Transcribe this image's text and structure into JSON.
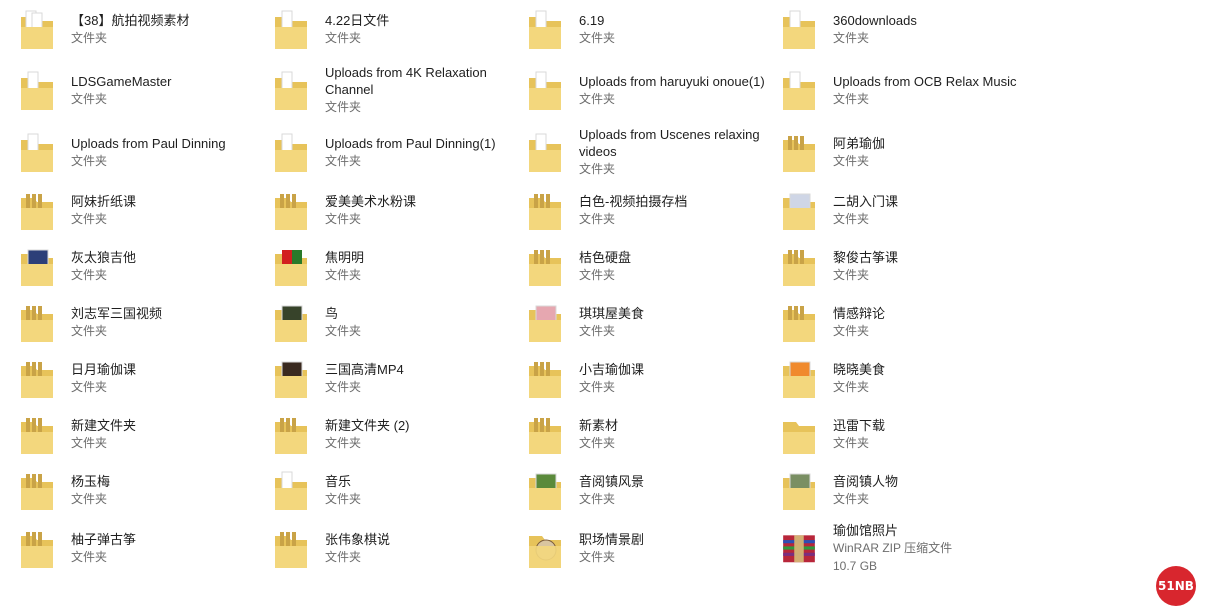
{
  "items": [
    {
      "name": "【38】航拍视频素材",
      "type": "文件夹",
      "icon": "folder-icon"
    },
    {
      "name": "4.22日文件",
      "type": "文件夹",
      "icon": "folder-icon"
    },
    {
      "name": "6.19",
      "type": "文件夹",
      "icon": "folder-icon"
    },
    {
      "name": "360downloads",
      "type": "文件夹",
      "icon": "folder-icon"
    },
    {
      "name": "LDSGameMaster",
      "type": "文件夹",
      "icon": "folder-icon"
    },
    {
      "name": "Uploads from 4K Relaxation Channel",
      "type": "文件夹",
      "icon": "folder-icon"
    },
    {
      "name": "Uploads from haruyuki onoue(1)",
      "type": "文件夹",
      "icon": "folder-icon"
    },
    {
      "name": "Uploads from OCB Relax Music",
      "type": "文件夹",
      "icon": "folder-icon"
    },
    {
      "name": "Uploads from Paul Dinning",
      "type": "文件夹",
      "icon": "folder-icon"
    },
    {
      "name": "Uploads from Paul Dinning(1)",
      "type": "文件夹",
      "icon": "folder-icon"
    },
    {
      "name": "Uploads from Uscenes relaxing videos",
      "type": "文件夹",
      "icon": "folder-icon"
    },
    {
      "name": "阿弟瑜伽",
      "type": "文件夹",
      "icon": "folder-icon"
    },
    {
      "name": "阿妹折纸课",
      "type": "文件夹",
      "icon": "folder-icon"
    },
    {
      "name": "爱美美术水粉课",
      "type": "文件夹",
      "icon": "folder-icon"
    },
    {
      "name": "白色-视频拍摄存档",
      "type": "文件夹",
      "icon": "folder-icon"
    },
    {
      "name": "二胡入门课",
      "type": "文件夹",
      "icon": "folder-icon"
    },
    {
      "name": "灰太狼吉他",
      "type": "文件夹",
      "icon": "folder-icon"
    },
    {
      "name": "焦明明",
      "type": "文件夹",
      "icon": "folder-icon"
    },
    {
      "name": "桔色硬盘",
      "type": "文件夹",
      "icon": "folder-icon"
    },
    {
      "name": "黎俊古筝课",
      "type": "文件夹",
      "icon": "folder-icon"
    },
    {
      "name": "刘志军三国视频",
      "type": "文件夹",
      "icon": "folder-icon"
    },
    {
      "name": "鸟",
      "type": "文件夹",
      "icon": "folder-icon"
    },
    {
      "name": "琪琪屋美食",
      "type": "文件夹",
      "icon": "folder-icon"
    },
    {
      "name": "情感辩论",
      "type": "文件夹",
      "icon": "folder-icon"
    },
    {
      "name": "日月瑜伽课",
      "type": "文件夹",
      "icon": "folder-icon"
    },
    {
      "name": "三国高清MP4",
      "type": "文件夹",
      "icon": "folder-icon"
    },
    {
      "name": "小吉瑜伽课",
      "type": "文件夹",
      "icon": "folder-icon"
    },
    {
      "name": "晓晓美食",
      "type": "文件夹",
      "icon": "folder-icon"
    },
    {
      "name": "新建文件夹",
      "type": "文件夹",
      "icon": "folder-icon"
    },
    {
      "name": "新建文件夹 (2)",
      "type": "文件夹",
      "icon": "folder-icon"
    },
    {
      "name": "新素材",
      "type": "文件夹",
      "icon": "folder-icon"
    },
    {
      "name": "迅雷下载",
      "type": "文件夹",
      "icon": "folder-icon"
    },
    {
      "name": "杨玉梅",
      "type": "文件夹",
      "icon": "folder-icon"
    },
    {
      "name": "音乐",
      "type": "文件夹",
      "icon": "folder-icon"
    },
    {
      "name": "音阅镇风景",
      "type": "文件夹",
      "icon": "folder-icon"
    },
    {
      "name": "音阅镇人物",
      "type": "文件夹",
      "icon": "folder-icon"
    },
    {
      "name": "柚子弹古筝",
      "type": "文件夹",
      "icon": "folder-icon"
    },
    {
      "name": "张伟象棋说",
      "type": "文件夹",
      "icon": "folder-icon"
    },
    {
      "name": "职场情景剧",
      "type": "文件夹",
      "icon": "folder-icon"
    },
    {
      "name": "瑜伽馆照片",
      "type": "WinRAR ZIP 压缩文件",
      "size": "10.7 GB",
      "icon": "winrar-archive-icon"
    }
  ],
  "colors": {
    "folder_front": "#f3d77d",
    "folder_back": "#e7c35a",
    "winrar_red": "#b8263a",
    "watermark": "#d8262e"
  },
  "watermark": {
    "text": "51NB"
  }
}
